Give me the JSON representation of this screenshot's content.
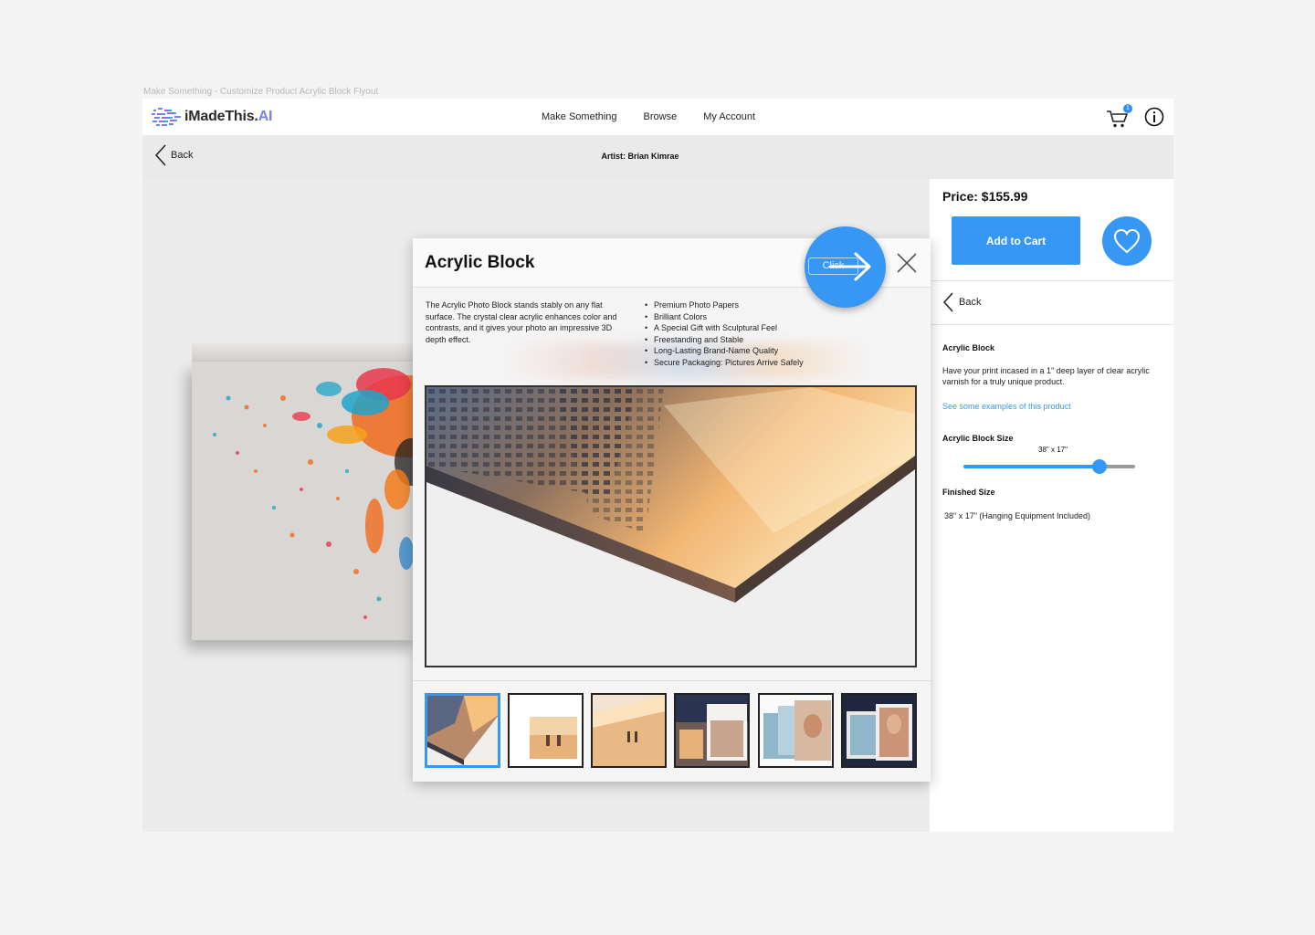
{
  "frame_label": "Make Something - Customize Product Acrylic Block Flyout",
  "brand": {
    "name": "iMadeThis.",
    "suffix": "AI"
  },
  "nav": {
    "items": [
      "Make Something",
      "Browse",
      "My Account"
    ]
  },
  "cart": {
    "count": "1",
    "icon": "cart-icon"
  },
  "info_icon": "info-icon",
  "subheader": {
    "back_label": "Back",
    "artist": "Artist: Brian Kimrae"
  },
  "panel": {
    "price": "Price: $155.99",
    "add_to_cart": "Add to Cart",
    "favorite_icon": "heart-icon",
    "back_label": "Back",
    "product_name": "Acrylic Block",
    "product_desc": "Have your print incased in a 1\" deep layer of clear acrylic varnish for a truly unique product.",
    "examples_link": "See some examples of this product",
    "size_label": "Acrylic Block Size",
    "size_value": "38\" x 17\"",
    "size_slider_fraction": 0.79,
    "finished_label": "Finished Size",
    "finished_value": "38\" x 17\"  (Hanging Equipment Included)"
  },
  "modal": {
    "title": "Acrylic Block",
    "click_label": "Click",
    "description": "The Acrylic Photo Block stands stably on any flat surface. The crystal clear acrylic enhances color and contrasts, and it gives your photo an impressive 3D depth effect.",
    "features": [
      "Premium Photo Papers",
      "Brilliant Colors",
      "A Special Gift with Sculptural Feel",
      "Freestanding and Stable",
      "Long-Lasting Brand-Name Quality",
      "Secure Packaging: Pictures Arrive Safely"
    ],
    "thumbnail_count": 6,
    "selected_thumbnail": 1
  },
  "colors": {
    "accent": "#3797f5",
    "logo_ai": "#7b7ff0"
  }
}
